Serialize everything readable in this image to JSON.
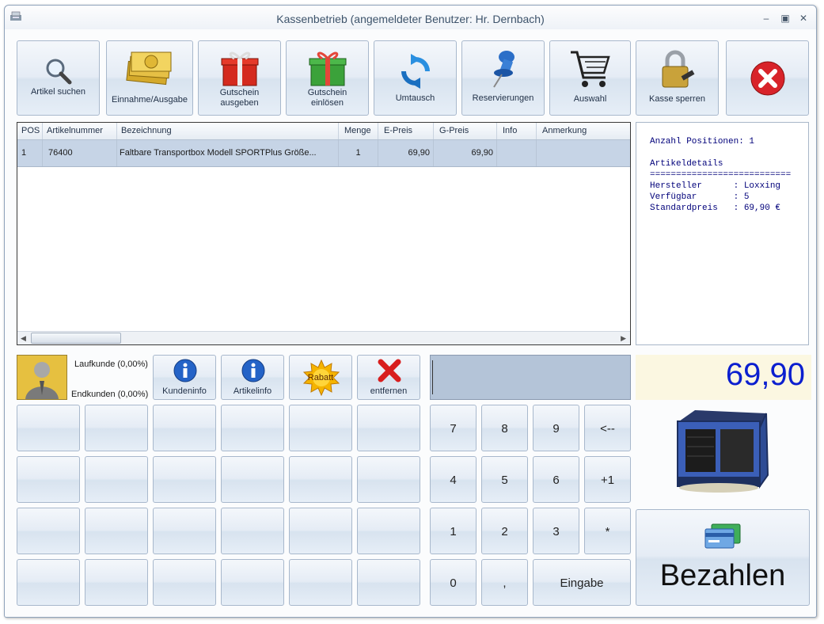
{
  "window": {
    "title": "Kassenbetrieb (angemeldeter Benutzer: Hr. Dernbach)"
  },
  "toolbar": [
    {
      "label": "Artikel suchen",
      "icon": "search-icon"
    },
    {
      "label": "Einnahme/Ausgabe",
      "icon": "money-icon"
    },
    {
      "label": "Gutschein ausgeben",
      "icon": "red-gift-icon"
    },
    {
      "label": "Gutschein einlösen",
      "icon": "green-gift-icon"
    },
    {
      "label": "Umtausch",
      "icon": "refresh-icon"
    },
    {
      "label": "Reservierungen",
      "icon": "pushpin-icon"
    },
    {
      "label": "Auswahl",
      "icon": "shopping-cart-icon"
    },
    {
      "label": "Kasse sperren",
      "icon": "padlock-icon"
    },
    {
      "label": "",
      "icon": "close-icon"
    }
  ],
  "grid": {
    "columns": [
      "POS",
      "Artikelnummer",
      "Bezeichnung",
      "Menge",
      "E-Preis",
      "G-Preis",
      "Info",
      "Anmerkung"
    ],
    "rows": [
      {
        "pos": "1",
        "artikelnummer": "76400",
        "bezeichnung": "Faltbare Transportbox Modell SPORTPlus Größe...",
        "menge": "1",
        "epreis": "69,90",
        "gpreis": "69,90",
        "info": "",
        "anmerkung": ""
      }
    ]
  },
  "info_panel": {
    "positions": "Anzahl Positionen: 1",
    "details_title": "Artikeldetails",
    "separator": "===========================",
    "hersteller": "Hersteller      : Loxxing",
    "verfuegbar": "Verfügbar       : 5",
    "standardpreis": "Standardpreis   : 69,90 €"
  },
  "customer": {
    "laufkunde": "Laufkunde (0,00%)",
    "endkunden": "Endkunden (0,00%)"
  },
  "actions": [
    {
      "label": "Kundeninfo",
      "icon": "info-icon"
    },
    {
      "label": "Artikelinfo",
      "icon": "info-icon"
    },
    {
      "label": "Rabatt",
      "icon": "sun-badge-icon"
    },
    {
      "label": "entfernen",
      "icon": "red-x-icon"
    }
  ],
  "keypad": [
    "7",
    "8",
    "9",
    "<--",
    "4",
    "5",
    "6",
    "+1",
    "1",
    "2",
    "3",
    "*",
    "0",
    ",",
    "Eingabe"
  ],
  "total": "69,90",
  "pay_label": "Bezahlen",
  "colors": {
    "total": "#0b1fcf",
    "selected_row": "#c6d4e6",
    "display": "#b4c4d8"
  }
}
